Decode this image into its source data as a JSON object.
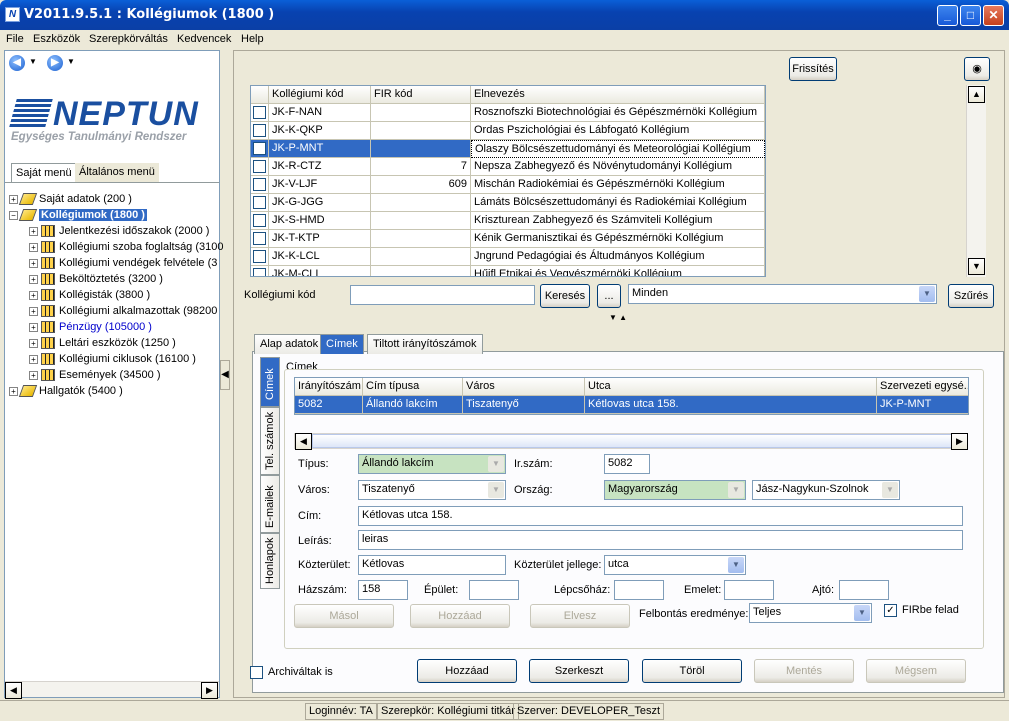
{
  "window": {
    "title": "V2011.9.5.1 : Kollégiumok (1800  )"
  },
  "menu": [
    "File",
    "Eszközök",
    "Szerepkörváltás",
    "Kedvencek",
    "Help"
  ],
  "logo": {
    "name": "NEPTUN",
    "slogan": "Egységes Tanulmányi Rendszer"
  },
  "left_tabs": [
    "Saját menü",
    "Általános menü"
  ],
  "tree": [
    {
      "label": "Saját adatok (200 )",
      "level": 0
    },
    {
      "label": "Kollégiumok (1800  )",
      "level": 0,
      "selected": true
    },
    {
      "label": "Jelentkezési időszakok (2000  )",
      "level": 1
    },
    {
      "label": "Kollégiumi szoba foglaltság (3100",
      "level": 1
    },
    {
      "label": "Kollégiumi vendégek felvétele (3",
      "level": 1
    },
    {
      "label": "Beköltöztetés (3200  )",
      "level": 1
    },
    {
      "label": "Kollégisták (3800  )",
      "level": 1
    },
    {
      "label": "Kollégiumi alkalmazottak (98200",
      "level": 1
    },
    {
      "label": "Pénzügy (105000  )",
      "level": 1,
      "blue": true
    },
    {
      "label": "Leltári eszközök (1250  )",
      "level": 1
    },
    {
      "label": "Kollégiumi ciklusok (16100  )",
      "level": 1
    },
    {
      "label": "Események (34500  )",
      "level": 1
    },
    {
      "label": "Hallgatók (5400  )",
      "level": 0
    }
  ],
  "toolbar": {
    "refresh": "Frissítés"
  },
  "main_grid": {
    "columns": [
      "Kollégiumi kód",
      "FIR kód",
      "Elnevezés"
    ],
    "rows": [
      [
        "JK-F-NAN",
        "",
        "Rosznofszki Biotechnológiai és Gépészmérnöki Kollégium"
      ],
      [
        "JK-K-QKP",
        "",
        "Ordas Pszichológiai és Lábfogató Kollégium"
      ],
      [
        "JK-P-MNT",
        "",
        "Olaszy Bölcsészettudományi és Meteorológiai Kollégium"
      ],
      [
        "JK-R-CTZ",
        "7",
        "Nepsza Zabhegyező és Növénytudományi Kollégium"
      ],
      [
        "JK-V-LJF",
        "609",
        "Mischán Radiokémiai és Gépészmérnöki Kollégium"
      ],
      [
        "JK-G-JGG",
        "",
        "Lámáts Bölcsészettudományi és Radiokémiai Kollégium"
      ],
      [
        "JK-S-HMD",
        "",
        "Kriszturean Zabhegyező és Számviteli Kollégium"
      ],
      [
        "JK-T-KTP",
        "",
        "Kénik Germanisztikai és Gépészmérnöki Kollégium"
      ],
      [
        "JK-K-LCL",
        "",
        "Jngrund Pedagógiai és Áltudmányos Kollégium"
      ],
      [
        "JK-M-CLI",
        "",
        "Hűjfl Etnikai és Vegyészmérnöki Kollégium"
      ]
    ]
  },
  "search": {
    "label": "Kollégiumi kód",
    "value": "",
    "search_btn": "Keresés",
    "dots_btn": "...",
    "filter_value": "Minden",
    "filter_btn": "Szűrés"
  },
  "detail_tabs": [
    "Alap adatok",
    "Címek",
    "Tiltott irányítószámok"
  ],
  "vertical_tabs": [
    "Címek",
    "Tel. számok",
    "E-mailek",
    "Honlapok"
  ],
  "address_group": "Címek",
  "address_grid": {
    "columns": [
      "Irányítószám",
      "Cím típusa",
      "Város",
      "Utca",
      "Szervezeti egysé..."
    ],
    "rows": [
      [
        "5082",
        "Állandó lakcím",
        "Tiszatenyő",
        "Kétlovas utca 158.",
        "JK-P-MNT"
      ]
    ]
  },
  "form": {
    "tipus_label": "Típus:",
    "tipus_value": "Állandó lakcím",
    "irszam_label": "Ir.szám:",
    "irszam_value": "5082",
    "varos_label": "Város:",
    "varos_value": "Tiszatenyő",
    "orszag_label": "Ország:",
    "orszag_value": "Magyarország",
    "megye_value": "Jász-Nagykun-Szolnok",
    "cim_label": "Cím:",
    "cim_value": "Kétlovas utca 158.",
    "leiras_label": "Leírás:",
    "leiras_value": "leiras",
    "kozterulet_label": "Közterület:",
    "kozterulet_value": "Kétlovas",
    "jellege_label": "Közterület jellege:",
    "jellege_value": "utca",
    "hazszam_label": "Házszám:",
    "hazszam_value": "158",
    "epulet_label": "Épület:",
    "epulet_value": "",
    "lepcsohaz_label": "Lépcsőház:",
    "lepcsohaz_value": "",
    "emelet_label": "Emelet:",
    "emelet_value": "",
    "ajto_label": "Ajtó:",
    "ajto_value": "",
    "masol": "Másol",
    "hozzaad": "Hozzáad",
    "elvesz": "Elvesz",
    "felbontas_label": "Felbontás eredménye:",
    "felbontas_value": "Teljes",
    "firbe_label": "FIRbe felad"
  },
  "bottom": {
    "archived": "Archiváltak is",
    "add": "Hozzáad",
    "edit": "Szerkeszt",
    "delete": "Töröl",
    "save": "Mentés",
    "cancel": "Mégsem"
  },
  "status": {
    "login": "Loginnév: TA",
    "role": "Szerepkör: Kollégiumi titkár",
    "server": "Szerver: DEVELOPER_Teszt"
  }
}
